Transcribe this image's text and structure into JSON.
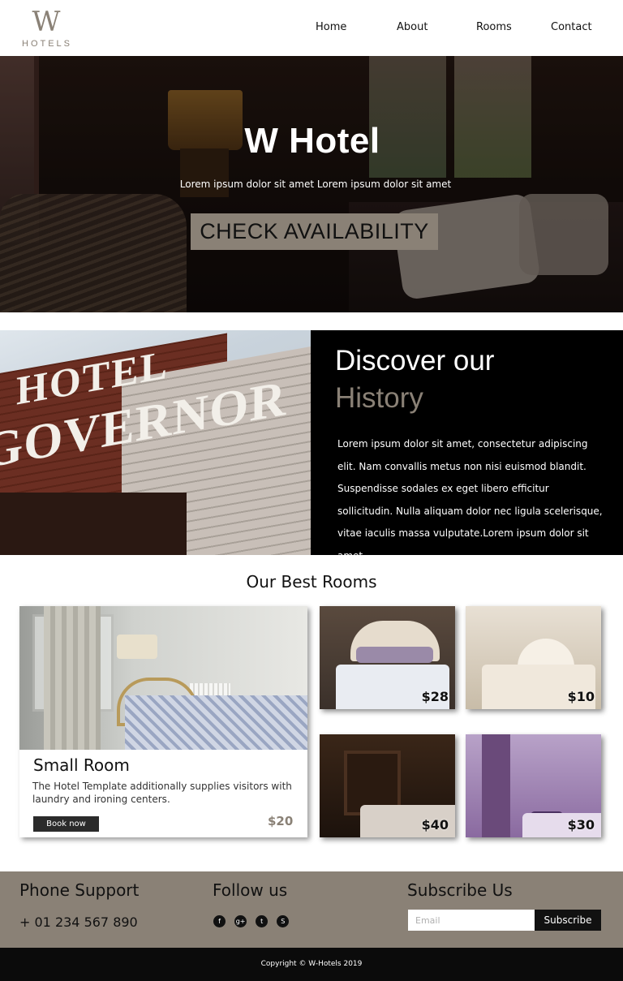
{
  "brand": {
    "logo_letter": "W",
    "logo_sub": "HOTELS"
  },
  "nav": {
    "home": "Home",
    "about": "About",
    "rooms": "Rooms",
    "contact": "Contact"
  },
  "hero": {
    "title": "W Hotel",
    "subtitle": "Lorem ipsum dolor sit amet Lorem ipsum dolor sit amet",
    "button": "CHECK AVAILABILITY"
  },
  "history": {
    "title_line1": "Discover our",
    "title_line2": "History",
    "body": "Lorem ipsum dolor sit amet, consectetur adipiscing elit. Nam convallis metus non nisi euismod blandit. Suspendisse sodales ex eget libero efficitur sollicitudin. Nulla aliquam dolor nec ligula scelerisque, vitae iaculis massa vulputate.Lorem ipsum dolor sit amet,",
    "sign_line1": "HOTEL",
    "sign_line2": "GOVERNOR"
  },
  "rooms": {
    "section_title": "Our Best Rooms",
    "featured": {
      "name": "Small Room",
      "description": "The Hotel Template additionally supplies visitors with laundry and ironing centers.",
      "book_label": "Book now",
      "price": "$20"
    },
    "thumbs": [
      {
        "price": "$28"
      },
      {
        "price": "$10"
      },
      {
        "price": "$40"
      },
      {
        "price": "$30"
      }
    ]
  },
  "footer": {
    "phone_heading": "Phone Support",
    "phone": "+ 01 234 567 890",
    "follow_heading": "Follow us",
    "social_icons": [
      "facebook-icon",
      "google-plus-icon",
      "twitter-icon",
      "skype-icon"
    ],
    "subscribe_heading": "Subscribe Us",
    "email_placeholder": "Email",
    "subscribe_label": "Subscribe",
    "copyright": "Copyright © W-Hotels 2019"
  },
  "colors": {
    "accent": "#8a8176",
    "dark": "#000000",
    "footer_bottom": "#0b0b0b"
  }
}
